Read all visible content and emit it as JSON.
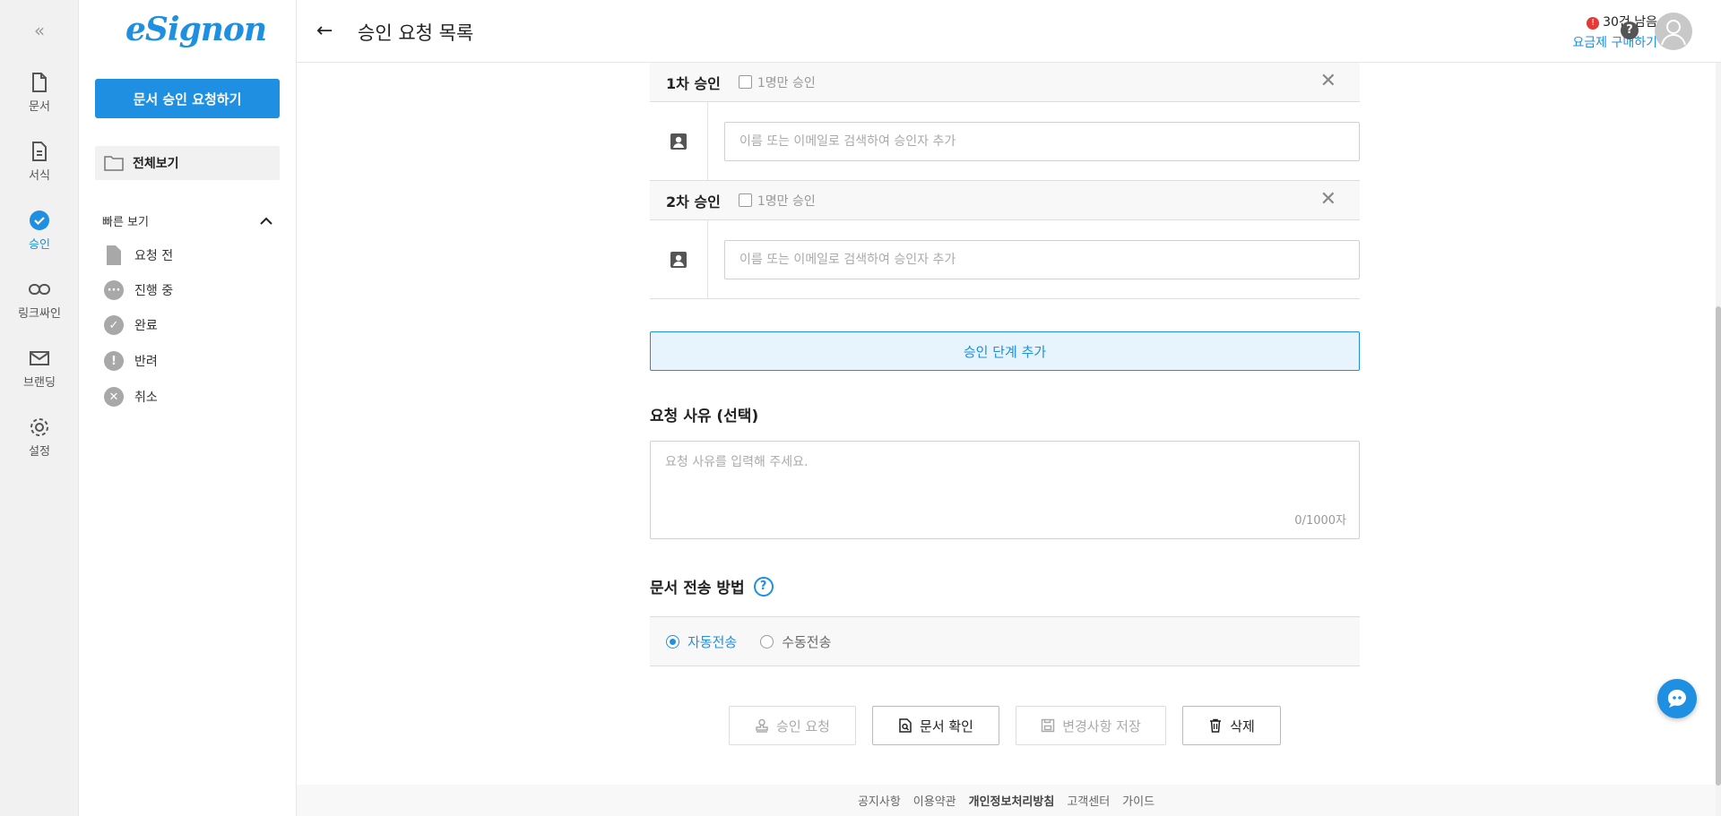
{
  "rail": {
    "items": [
      {
        "label": "문서",
        "icon": "document-icon"
      },
      {
        "label": "서식",
        "icon": "template-icon"
      },
      {
        "label": "승인",
        "icon": "approval-check-icon"
      },
      {
        "label": "링크싸인",
        "icon": "link-icon"
      },
      {
        "label": "브랜딩",
        "icon": "mail-icon"
      },
      {
        "label": "설정",
        "icon": "gear-icon"
      }
    ],
    "active": "승인"
  },
  "sidebar": {
    "logo": "eSignon",
    "primary_button": "문서 승인 요청하기",
    "all_view": "전체보기",
    "quick_view_title": "빠른 보기",
    "quick_items": [
      "요청 전",
      "진행 중",
      "완료",
      "반려",
      "취소"
    ]
  },
  "header": {
    "title": "승인 요청 목록",
    "remain_count": "30건 남음",
    "buy_plan": "요금제 구매하기"
  },
  "steps": [
    {
      "name": "1차 승인",
      "checkbox_label": "1명만 승인",
      "input_placeholder": "이름 또는 이메일로 검색하여 승인자 추가"
    },
    {
      "name": "2차 승인",
      "checkbox_label": "1명만 승인",
      "input_placeholder": "이름 또는 이메일로 검색하여 승인자 추가"
    }
  ],
  "add_step_button": "승인 단계 추가",
  "reason": {
    "title": "요청 사유 (선택)",
    "placeholder": "요청 사유를 입력해 주세요.",
    "counter": "0/1000자"
  },
  "send_method": {
    "title": "문서 전송 방법",
    "options": [
      "자동전송",
      "수동전송"
    ],
    "selected": "자동전송"
  },
  "actions": {
    "request": "승인 요청",
    "confirm": "문서 확인",
    "save": "변경사항 저장",
    "delete": "삭제"
  },
  "footer": [
    "공지사항",
    "이용약관",
    "개인정보처리방침",
    "고객센터",
    "가이드"
  ],
  "colors": {
    "accent": "#1e8fe1",
    "alert": "#e53935"
  }
}
